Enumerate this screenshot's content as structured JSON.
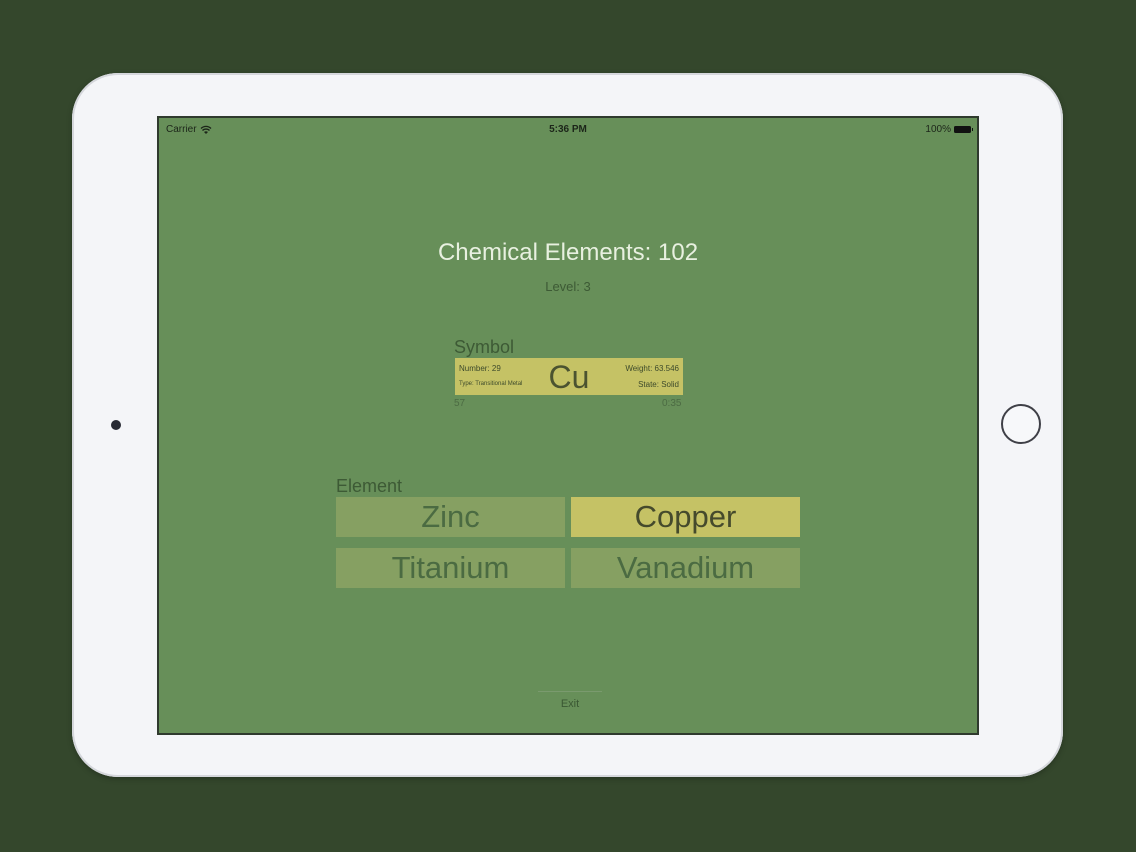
{
  "status_bar": {
    "carrier": "Carrier",
    "time": "5:36 PM",
    "battery": "100%"
  },
  "game": {
    "title": "Chemical Elements: 102",
    "level": "Level: 3"
  },
  "symbol_section": {
    "label": "Symbol",
    "card": {
      "number": "Number: 29",
      "type": "Type: Transitional Metal",
      "weight": "Weight: 63.546",
      "state": "State: Solid",
      "symbol": "Cu"
    },
    "footer_left": "57",
    "footer_right": "0:35"
  },
  "element_section": {
    "label": "Element",
    "options": [
      {
        "label": "Zinc",
        "selected": false
      },
      {
        "label": "Copper",
        "selected": true
      },
      {
        "label": "Titanium",
        "selected": false
      },
      {
        "label": "Vanadium",
        "selected": false
      }
    ]
  },
  "exit_label": "Exit",
  "colors": {
    "background": "#34472c",
    "screen": "#678f59",
    "card": "#c5c265",
    "option": "#86a062"
  }
}
